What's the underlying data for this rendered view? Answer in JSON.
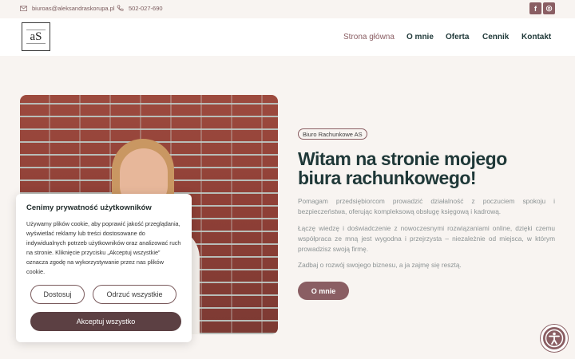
{
  "topbar": {
    "email": "biuroas@aleksandraskorupa.pl",
    "phone": "502-027-690",
    "social": [
      {
        "icon": "facebook-icon",
        "glyph": "f"
      },
      {
        "icon": "instagram-icon",
        "glyph": "◎"
      }
    ]
  },
  "logo": {
    "monogram": "aS"
  },
  "nav": {
    "items": [
      {
        "label": "Strona główna",
        "active": true
      },
      {
        "label": "O mnie",
        "active": false
      },
      {
        "label": "Oferta",
        "active": false
      },
      {
        "label": "Cennik",
        "active": false
      },
      {
        "label": "Kontakt",
        "active": false
      }
    ]
  },
  "hero": {
    "badge": "Biuro Rachunkowe AS",
    "title": "Witam na stronie mojego biura rachunkowego!",
    "paragraphs": [
      "Pomagam przedsiębiorcom prowadzić działalność z poczuciem spokoju i bezpieczeństwa, oferując kompleksową obsługę księgową i kadrową.",
      "Łączę wiedzę i doświadczenie z nowoczesnymi rozwiązaniami online, dzięki czemu współpraca ze mną jest wygodna i przejrzysta – niezależnie od miejsca, w którym prowadzisz swoją firmę.",
      "Zadbaj o rozwój swojego biznesu, a ja zajmę się resztą."
    ],
    "cta_label": "O mnie"
  },
  "cookie": {
    "title": "Cenimy prywatność użytkowników",
    "text": "Używamy plików cookie, aby poprawić jakość przeglądania, wyświetlać reklamy lub treści dostosowane do indywidualnych potrzeb użytkowników oraz analizować ruch na stronie. Kliknięcie przycisku „Akceptuj wszystkie” oznacza zgodę na wykorzystywanie przez nas plików cookie.",
    "allow_label": "Dostosuj",
    "reject_label": "Odrzuć wszystkie",
    "accept_label": "Akceptuj wszystko"
  },
  "colors": {
    "accent": "#8a5e63",
    "dark_accent": "#5c4043",
    "heading": "#1f3838",
    "background": "#f8f4f1"
  }
}
